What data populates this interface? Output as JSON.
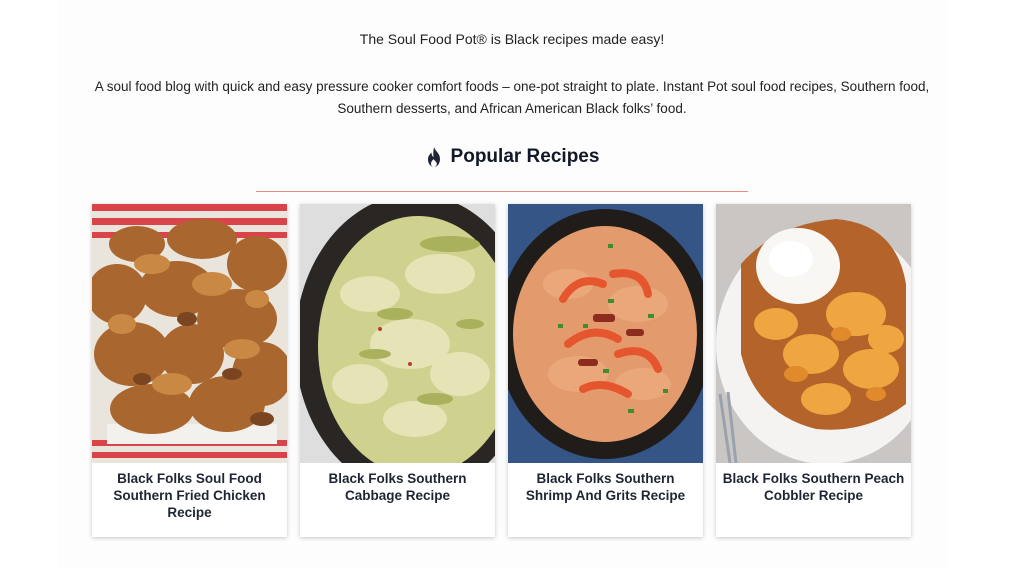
{
  "site": {
    "tagline": "The Soul Food Pot® is Black recipes made easy!",
    "intro": "A soul food blog with quick and easy pressure cooker comfort foods – one-pot straight to plate. Instant Pot soul food recipes, Southern food, Southern desserts, and African American Black folks’ food."
  },
  "popular": {
    "heading": "Popular Recipes",
    "icon": "fire-icon",
    "rule_color": "#ef8a84",
    "recipes": [
      {
        "title": "Black Folks Soul Food Southern Fried Chicken Recipe",
        "image": "fried-chicken-photo"
      },
      {
        "title": "Black Folks Southern Cabbage Recipe",
        "image": "cabbage-photo"
      },
      {
        "title": "Black Folks Southern Shrimp And Grits Recipe",
        "image": "shrimp-and-grits-photo"
      },
      {
        "title": "Black Folks Southern Peach Cobbler Recipe",
        "image": "peach-cobbler-photo"
      }
    ]
  }
}
